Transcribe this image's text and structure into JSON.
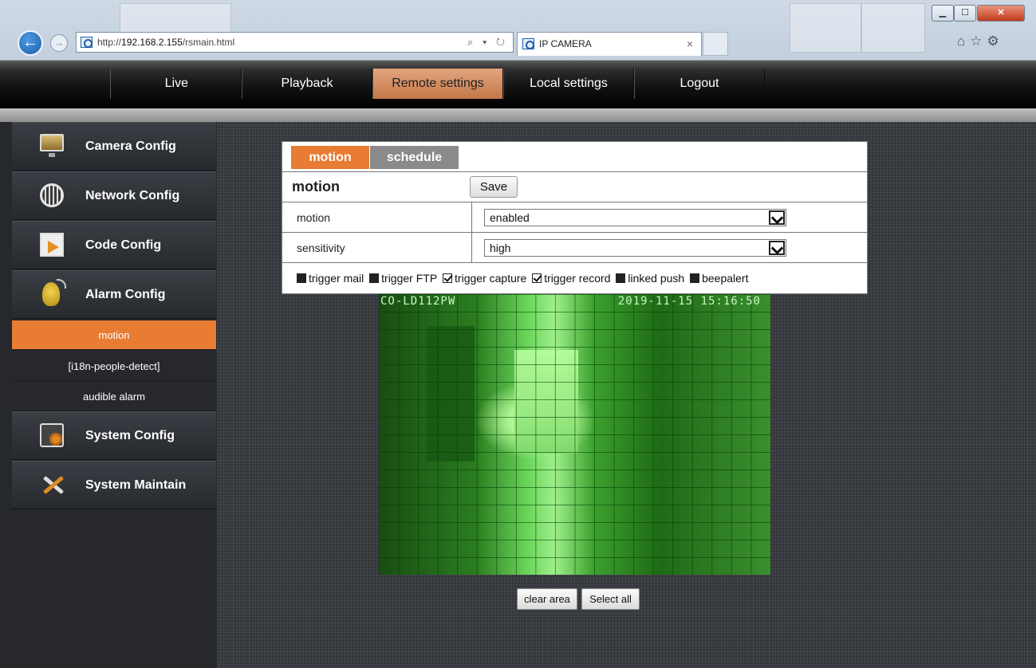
{
  "browser": {
    "url_prefix": "http://",
    "url_host": "192.168.2.155",
    "url_path": "/rsmain.html",
    "address_icons": "⌕ ▾ ↻",
    "tab_title": "IP CAMERA",
    "tab_close": "×",
    "window_controls": {
      "minimize": "▁",
      "maximize": "☐",
      "close": "✕"
    },
    "tools": "⌂☆⚙"
  },
  "nav": {
    "items": [
      "Live",
      "Playback",
      "Remote settings",
      "Local settings",
      "Logout"
    ],
    "active": "Remote settings"
  },
  "sidebar": {
    "groups": [
      {
        "label": "Camera Config",
        "icon": "monitor-icon"
      },
      {
        "label": "Network Config",
        "icon": "globe-icon"
      },
      {
        "label": "Code Config",
        "icon": "film-icon"
      },
      {
        "label": "Alarm Config",
        "icon": "alarm-icon"
      },
      {
        "label": "System Config",
        "icon": "gear-doc-icon"
      },
      {
        "label": "System Maintain",
        "icon": "tools-icon"
      }
    ],
    "alarm_sub": [
      "motion",
      "[i18n-people-detect]",
      "audible alarm"
    ],
    "active_sub": "motion"
  },
  "panel": {
    "tabs": [
      "motion",
      "schedule"
    ],
    "active_tab": "motion",
    "section_title": "motion",
    "save_label": "Save",
    "rows": [
      {
        "label": "motion",
        "value": "enabled"
      },
      {
        "label": "sensitivity",
        "value": "high"
      }
    ],
    "triggers": [
      {
        "label": "trigger mail",
        "checked": false
      },
      {
        "label": "trigger FTP",
        "checked": false
      },
      {
        "label": "trigger capture",
        "checked": true
      },
      {
        "label": "trigger record",
        "checked": true
      },
      {
        "label": "linked push",
        "checked": false
      },
      {
        "label": "beepalert",
        "checked": false
      }
    ]
  },
  "video": {
    "osd_name": "CO-LD112PW",
    "osd_time": "2019-11-15 15:16:50"
  },
  "buttons": {
    "clear_area": "clear area",
    "select_all": "Select all"
  },
  "colors": {
    "accent_orange": "#e87c32",
    "motion_overlay_green": "#1f8c12",
    "sidebar_bg": "#26282c"
  }
}
